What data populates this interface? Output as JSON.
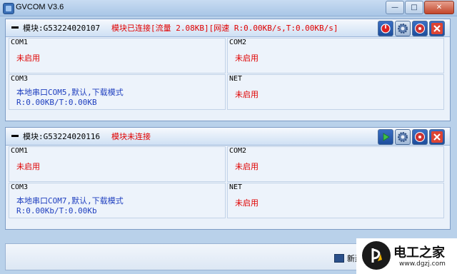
{
  "window": {
    "title": "GVCOM  V3.6",
    "minimize_glyph": "—",
    "maximize_glyph": "□",
    "close_glyph": "✕"
  },
  "modules": [
    {
      "title": "模块:G53224020107",
      "status": "模块已连接[流量 2.08KB][网速 R:0.00KB/s,T:0.00KB/s]",
      "cells": [
        {
          "label": "COM1",
          "lines": [
            "未启用"
          ]
        },
        {
          "label": "COM2",
          "lines": [
            "未启用"
          ]
        },
        {
          "label": "COM3",
          "lines": [
            "本地串口COM5,默认,下载模式",
            "R:0.00KB/T:0.00KB"
          ]
        },
        {
          "label": "NET",
          "lines": [
            "未启用"
          ]
        }
      ],
      "toolbar_icons": [
        "power-icon",
        "gear-icon",
        "disc-icon",
        "close-icon"
      ]
    },
    {
      "title": "模块:G53224020116",
      "status": "模块未连接",
      "cells": [
        {
          "label": "COM1",
          "lines": [
            "未启用"
          ]
        },
        {
          "label": "COM2",
          "lines": [
            "未启用"
          ]
        },
        {
          "label": "COM3",
          "lines": [
            "本地串口COM7,默认,下载模式",
            "R:0.00Kb/T:0.00Kb"
          ]
        },
        {
          "label": "NET",
          "lines": [
            "未启用"
          ]
        }
      ],
      "toolbar_icons": [
        "play-icon",
        "gear-icon",
        "disc-icon",
        "close-icon"
      ]
    }
  ],
  "statusbar": {
    "new_label": "新建"
  },
  "watermark": {
    "title": "电工之家",
    "url": "www.dgzj.com"
  },
  "colors": {
    "accent_red": "#e00000",
    "text_blue": "#1f3fbf",
    "background": "#b9d1ea"
  }
}
